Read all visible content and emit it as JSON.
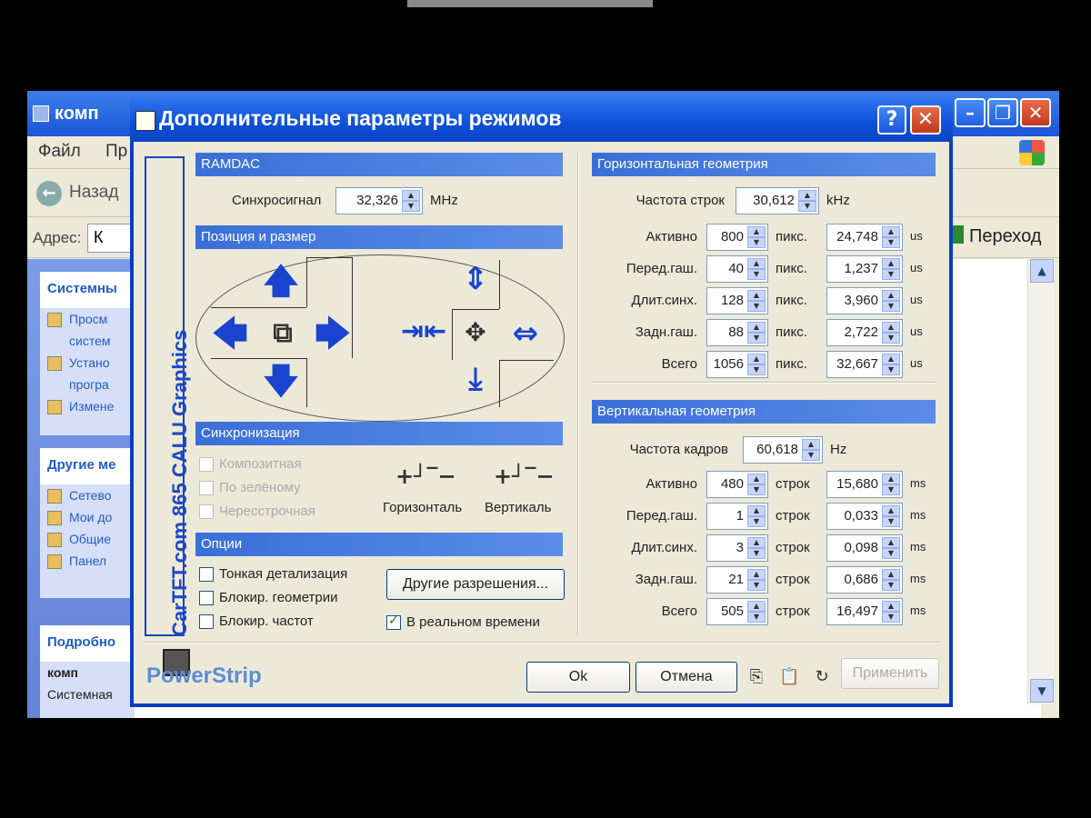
{
  "background_window": {
    "title": "комп",
    "menu": [
      "Файл",
      "Пр"
    ],
    "back_label": "Назад",
    "address_label": "Адрес:",
    "address_value": "К",
    "go_label": "Переход",
    "panels": [
      {
        "head": "Системны",
        "items": [
          "Просм",
          "систем",
          "Устано",
          "програ",
          "Измене"
        ]
      },
      {
        "head": "Другие ме",
        "items": [
          "Сетево",
          "Мои до",
          "Общие",
          "Панел"
        ]
      },
      {
        "head": "Подробно",
        "items": [
          "комп",
          "Системная"
        ]
      }
    ]
  },
  "dialog": {
    "title": "Дополнительные параметры режимов",
    "help": "?",
    "close": "✕",
    "brand": "CarTFT.com 865 CALU Graphics",
    "ramdac": {
      "head": "RAMDAC",
      "sync_label": "Синхросигнал",
      "sync_value": "32,326",
      "sync_unit": "MHz"
    },
    "position": {
      "head": "Позиция и размер"
    },
    "sync": {
      "head": "Синхронизация",
      "composite": "Композитная",
      "on_green": "По зелёному",
      "interlaced": "Чересстрочная",
      "horizontal": "Горизонталь",
      "vertical": "Вертикаль"
    },
    "options": {
      "head": "Опции",
      "fine_detail": "Тонкая детализация",
      "lock_geometry": "Блокир. геометрии",
      "lock_freq": "Блокир. частот",
      "other_res": "Другие разрешения...",
      "realtime": "В реальном времени",
      "realtime_checked": true
    },
    "hgeom": {
      "head": "Горизонтальная геометрия",
      "freq_label": "Частота строк",
      "freq_value": "30,612",
      "freq_unit": "kHz",
      "unit_pix": "пикс.",
      "unit_time": "us",
      "rows": [
        {
          "label": "Активно",
          "value": "800",
          "time": "24,748"
        },
        {
          "label": "Перед.гаш.",
          "value": "40",
          "time": "1,237"
        },
        {
          "label": "Длит.синх.",
          "value": "128",
          "time": "3,960"
        },
        {
          "label": "Задн.гаш.",
          "value": "88",
          "time": "2,722"
        },
        {
          "label": "Всего",
          "value": "1056",
          "time": "32,667"
        }
      ]
    },
    "vgeom": {
      "head": "Вертикальная геометрия",
      "freq_label": "Частота кадров",
      "freq_value": "60,618",
      "freq_unit": "Hz",
      "unit_lines": "строк",
      "unit_time": "ms",
      "rows": [
        {
          "label": "Активно",
          "value": "480",
          "time": "15,680"
        },
        {
          "label": "Перед.гаш.",
          "value": "1",
          "time": "0,033"
        },
        {
          "label": "Длит.синх.",
          "value": "3",
          "time": "0,098"
        },
        {
          "label": "Задн.гаш.",
          "value": "21",
          "time": "0,686"
        },
        {
          "label": "Всего",
          "value": "505",
          "time": "16,497"
        }
      ]
    },
    "footer": {
      "brand": "PowerStrip",
      "ok": "Ok",
      "cancel": "Отмена",
      "apply": "Применить"
    }
  }
}
